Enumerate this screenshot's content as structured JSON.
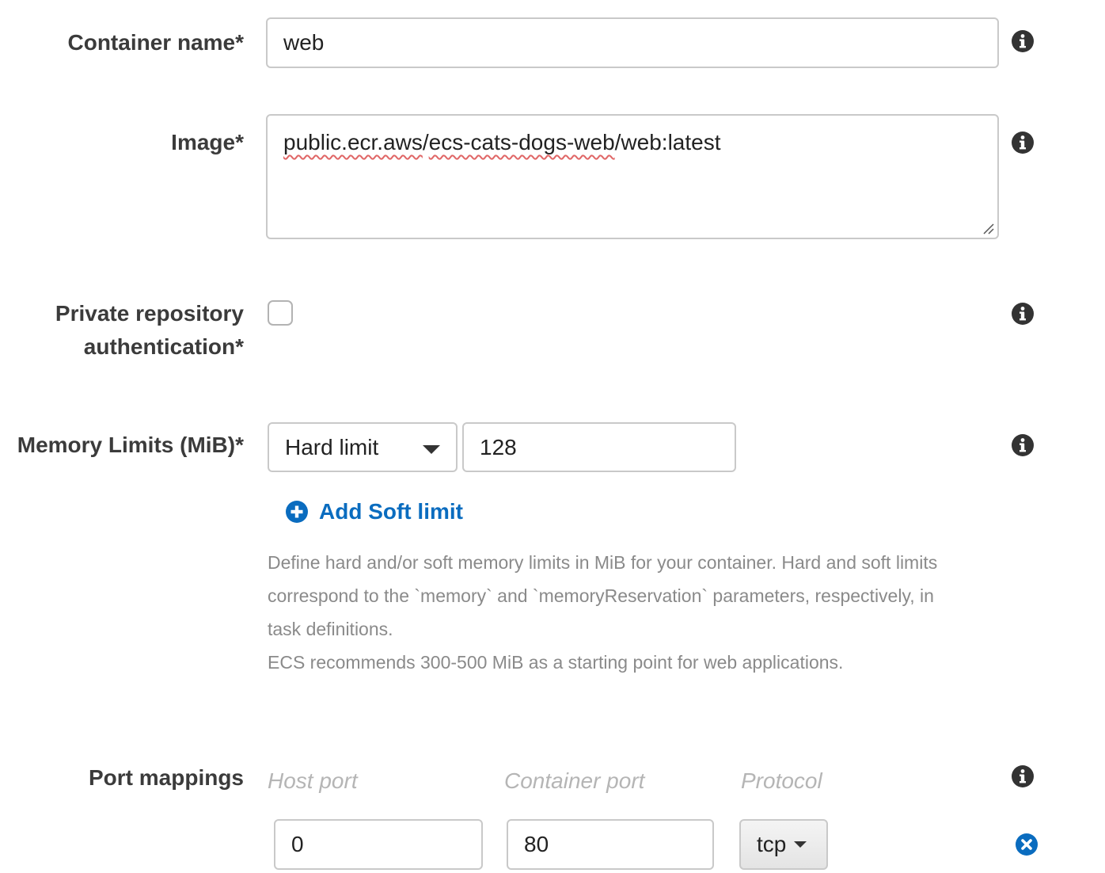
{
  "container_name": {
    "label": "Container name*",
    "value": "web"
  },
  "image": {
    "label": "Image*",
    "value_spell1": "public.ecr.aws",
    "value_sep": "/",
    "value_spell2": "ecs-cats-dogs-web",
    "value_rest": "/web:latest"
  },
  "private_repo": {
    "label_line1": "Private repository",
    "label_line2": "authentication*",
    "checked": false
  },
  "memory": {
    "label": "Memory Limits (MiB)*",
    "limit_type": "Hard limit",
    "value": "128",
    "add_soft_limit": "Add Soft limit",
    "help_line1": "Define hard and/or soft memory limits in MiB for your container. Hard and soft limits",
    "help_line2": "correspond to the `memory` and `memoryReservation` parameters, respectively, in",
    "help_line3": "task definitions.",
    "help_line4": "ECS recommends 300-500 MiB as a starting point for web applications."
  },
  "port_mappings": {
    "label": "Port mappings",
    "host_port_header": "Host port",
    "container_port_header": "Container port",
    "protocol_header": "Protocol",
    "rows": [
      {
        "host_port": "0",
        "container_port": "80",
        "protocol": "tcp"
      }
    ]
  },
  "icons": {
    "info": "info-icon",
    "add": "plus-circle-icon",
    "remove": "close-circle-icon"
  },
  "colors": {
    "link": "#0a6cbf",
    "label": "#3b3b3b",
    "help_text": "#8a8a8a",
    "placeholder_header": "#b5b5b5"
  }
}
